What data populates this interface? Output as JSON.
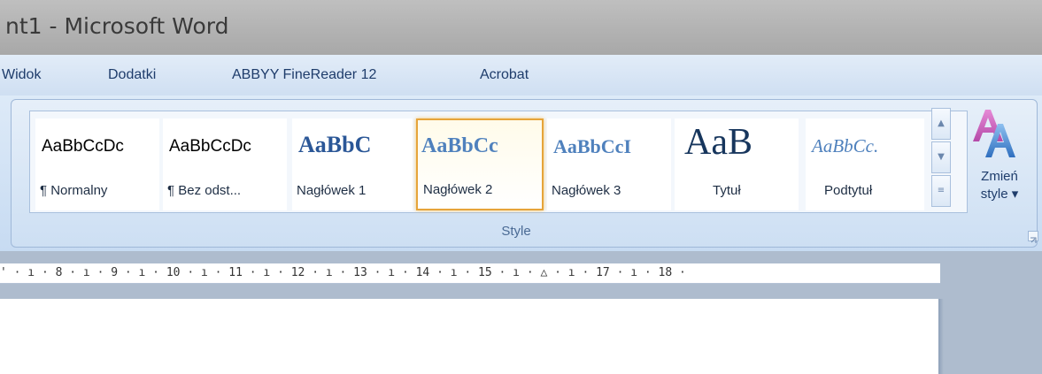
{
  "window": {
    "title": "nt1 - Microsoft Word"
  },
  "menu": {
    "items": [
      {
        "label": "Widok"
      },
      {
        "label": "Dodatki"
      },
      {
        "label": "ABBYY FineReader 12"
      },
      {
        "label": "Acrobat"
      }
    ]
  },
  "styles": {
    "group_label": "Style",
    "tiles": [
      {
        "sample": "AaBbCcDc",
        "name": "¶ Normalny",
        "selected": false
      },
      {
        "sample": "AaBbCcDc",
        "name": "¶ Bez odst...",
        "selected": false
      },
      {
        "sample": "AaBbC",
        "name": "Nagłówek 1",
        "selected": false
      },
      {
        "sample": "AaBbCc",
        "name": "Nagłówek 2",
        "selected": true
      },
      {
        "sample": "AaBbCcI",
        "name": "Nagłówek 3",
        "selected": false
      },
      {
        "sample": "AaB",
        "name": "Tytuł",
        "selected": false
      },
      {
        "sample": "AaBbCc.",
        "name": "Podtytuł",
        "selected": false
      }
    ],
    "change_styles": {
      "line1": "Zmień",
      "line2": "style ▾",
      "icon": "change-styles-icon"
    }
  },
  "ruler": {
    "ticks": "' · ı · 8 · ı · 9 · ı · 10 · ı · 11 · ı · 12 · ı · 13 · ı · 14 · ı · 15 · ı · △ · ı · 17 · ı · 18 ·"
  },
  "colors": {
    "selected_border": "#e6a43a",
    "heading_blue": "#2b5797",
    "menu_text": "#1e3c6b"
  }
}
